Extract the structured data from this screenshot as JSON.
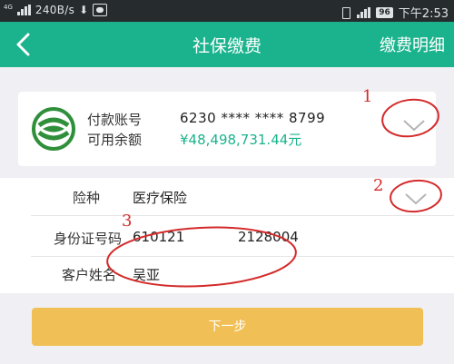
{
  "status_bar": {
    "network": "4G",
    "speed": "240B/s",
    "download_icon": "download-arrow-icon",
    "battery": "96",
    "time": "下午2:53"
  },
  "navbar": {
    "back_icon": "chevron-left-icon",
    "title": "社保缴费",
    "detail_link": "缴费明细"
  },
  "account_card": {
    "logo_icon": "bank-logo-icon",
    "account_label": "付款账号",
    "account_number": "6230 **** **** 8799",
    "balance_label": "可用余额",
    "balance_value": "¥48,498,731.44元"
  },
  "form": {
    "insurance_label": "险种",
    "insurance_value": "医疗保险",
    "id_label": "身份证号码",
    "id_part1": "610121",
    "id_part2": "2128004",
    "name_label": "客户姓名",
    "name_value": "吴亚"
  },
  "next_button": {
    "label": "下一步"
  },
  "annotations": {
    "mark1": "1",
    "mark2": "2",
    "mark3": "3",
    "color": "#d42a2a"
  },
  "colors": {
    "brand_green": "#1bb38d",
    "button_yellow": "#f0c056",
    "status_bar": "#262b2e"
  }
}
